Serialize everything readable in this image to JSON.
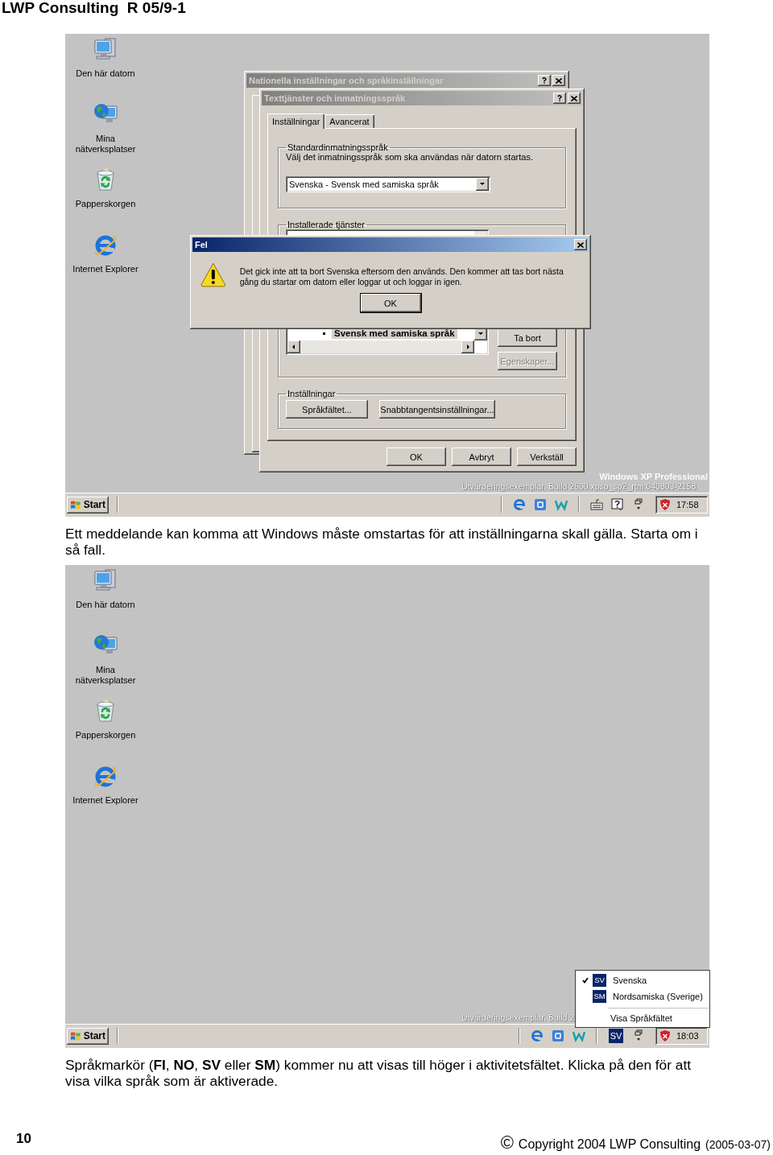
{
  "document": {
    "header": "LWP Consulting  R 05/9-1"
  },
  "figures": [
    {
      "desktop_icons": [
        {
          "kind": "computer",
          "label": "Den här datorn"
        },
        {
          "kind": "network",
          "label": "Mina nätverksplatser"
        },
        {
          "kind": "recycle_bin",
          "label": "Papperskorgen"
        },
        {
          "kind": "browser",
          "label": "Internet Explorer"
        }
      ],
      "dialogs": {
        "back": {
          "title": "Nationella inställningar och språkinställningar"
        },
        "front": {
          "title": "Texttjänster och inmatningsspråk",
          "tabs": [
            {
              "label": "Inställningar",
              "selected": true
            },
            {
              "label": "Avancerat",
              "selected": false
            }
          ],
          "default_language": {
            "legend": "Standardinmatningsspråk",
            "description": "Välj det inmatningsspråk som ska användas när datorn startas.",
            "value": "Svenska - Svensk med samiska språk"
          },
          "installed_services": {
            "legend": "Installerade tjänster",
            "items": [
              {
                "label": "Svensk med samiska språk",
                "selected": true
              }
            ],
            "buttons": [
              {
                "label": "Ta bort",
                "disabled": false
              },
              {
                "label": "Egenskaper...",
                "disabled": true
              }
            ]
          },
          "settings": {
            "legend": "Inställningar",
            "buttons": [
              "Språkfältet...",
              "Snabbtangentsinställningar..."
            ]
          },
          "buttons": [
            "OK",
            "Avbryt",
            "Verkställ"
          ]
        },
        "error": {
          "title": "Fel",
          "message": "Det gick inte att ta bort Svenska eftersom den används. Den kommer att tas bort nästa gång du startar om datorn eller loggar ut och loggar in igen.",
          "button": "OK"
        }
      },
      "watermark": {
        "edition": "Windows XP Professional",
        "build": "Utvärderingsexemplar. Build 2600.xpsp_sp2_rtm.040803-2158"
      },
      "taskbar": {
        "start": "Start",
        "tray_icons": [
          {
            "kind": "separator"
          },
          {
            "kind": "browser"
          },
          {
            "kind": "app"
          },
          {
            "kind": "word"
          },
          {
            "kind": "separator"
          },
          {
            "kind": "keyboard"
          },
          {
            "kind": "help"
          },
          {
            "kind": "restore"
          }
        ],
        "clock": "17:58"
      },
      "caption": "Ett meddelande kan komma att Windows måste omstartas för att inställningarna skall gälla. Starta om i så fall."
    },
    {
      "desktop_icons": [
        {
          "kind": "computer",
          "label": "Den här datorn"
        },
        {
          "kind": "network",
          "label": "Mina nätverksplatser"
        },
        {
          "kind": "recycle_bin",
          "label": "Papperskorgen"
        },
        {
          "kind": "browser",
          "label": "Internet Explorer"
        }
      ],
      "watermark": {
        "build": "Utvärderingsexemplar. Build 2"
      },
      "language_menu": {
        "items": [
          {
            "badge": "SV",
            "label": "Svenska",
            "checked": true
          },
          {
            "badge": "SM",
            "label": "Nordsamiska (Sverige)",
            "checked": false
          }
        ],
        "command": "Visa Språkfältet"
      },
      "taskbar": {
        "start": "Start",
        "tray_icons": [
          {
            "kind": "separator"
          },
          {
            "kind": "browser"
          },
          {
            "kind": "app"
          },
          {
            "kind": "word"
          },
          {
            "kind": "separator"
          },
          {
            "kind": "language",
            "label": "SV"
          },
          {
            "kind": "restore"
          }
        ],
        "clock": "18:03"
      },
      "caption": "Språkmarkör (**FI**, **NO**, **SV** eller **SM**) kommer nu att visas till höger i aktivitetsfältet. Klicka på den för att visa vilka språk som är aktiverade."
    }
  ],
  "footer": {
    "page": "10",
    "symbol": "©",
    "copyright": "Copyright 2004 LWP Consulting",
    "date": "(2005-03-07)"
  }
}
